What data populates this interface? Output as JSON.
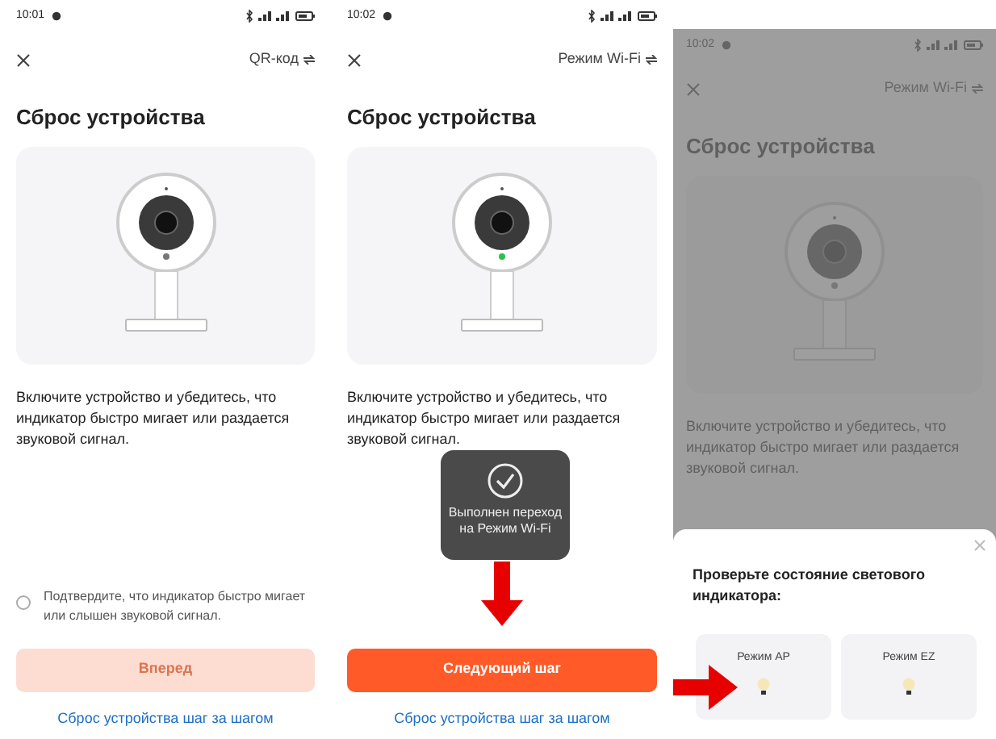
{
  "panels": [
    {
      "status_time": "10:01",
      "mode_switch": "QR-код",
      "title": "Сброс устройства",
      "description": "Включите устройство и убедитесь, что индикатор быстро мигает или раздается звуковой сигнал.",
      "confirm": {
        "text": "Подтвердите, что индикатор быстро мигает или слышен звуковой сигнал.",
        "checked": false
      },
      "primary_button": {
        "label": "Вперед",
        "disabled": true
      },
      "link": "Сброс устройства шаг за шагом",
      "indicator_on": false
    },
    {
      "status_time": "10:02",
      "mode_switch": "Режим Wi-Fi",
      "title": "Сброс устройства",
      "description": "Включите устройство и убедитесь, что индикатор быстро мигает или раздается звуковой сигнал.",
      "toast": "Выполнен переход на Режим Wi-Fi",
      "annotation_arrow": true,
      "primary_button": {
        "label": "Следующий шаг",
        "disabled": false
      },
      "link": "Сброс устройства шаг за шагом",
      "indicator_on": true
    },
    {
      "status_time": "10:02",
      "mode_switch": "Режим Wi-Fi",
      "title": "Сброс устройства",
      "description": "Включите устройство и убедитесь, что индикатор быстро мигает или раздается звуковой сигнал.",
      "indicator_on": false,
      "dimmed": true,
      "sheet": {
        "title": "Проверьте состояние светового индикатора:",
        "options": [
          {
            "label": "Режим AP"
          },
          {
            "label": "Режим EZ"
          }
        ],
        "annotation_arrow": true
      }
    }
  ]
}
